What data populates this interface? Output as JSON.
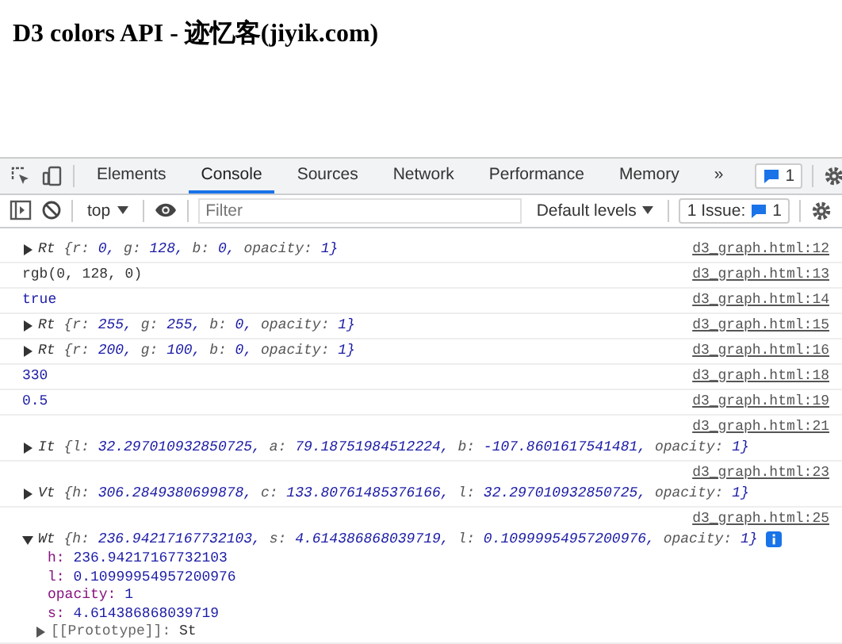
{
  "page": {
    "heading": "D3 colors API - 迹忆客(jiyik.com)"
  },
  "devtools": {
    "tabs": [
      {
        "label": "Elements",
        "selected": false
      },
      {
        "label": "Console",
        "selected": true
      },
      {
        "label": "Sources",
        "selected": false
      },
      {
        "label": "Network",
        "selected": false
      },
      {
        "label": "Performance",
        "selected": false
      },
      {
        "label": "Memory",
        "selected": false
      }
    ],
    "more_tabs": "»",
    "message_count": "1",
    "context": "top",
    "filter": {
      "placeholder": "Filter"
    },
    "levels": "Default levels",
    "issues": {
      "label": "1 Issue:",
      "count": "1"
    }
  },
  "console": [
    {
      "kind": "object",
      "class_name": "Rt",
      "expanded": false,
      "source": "d3_graph.html:12",
      "source_above": false,
      "props": [
        {
          "key": "{r:",
          "value": "0,"
        },
        {
          "key": "g:",
          "value": "128,"
        },
        {
          "key": "b:",
          "value": "0,"
        },
        {
          "key": "opacity:",
          "value": "1}"
        }
      ]
    },
    {
      "kind": "string",
      "text": "rgb(0, 128, 0)",
      "source": "d3_graph.html:13",
      "source_above": false
    },
    {
      "kind": "number",
      "text": "true",
      "source": "d3_graph.html:14",
      "source_above": false
    },
    {
      "kind": "object",
      "class_name": "Rt",
      "expanded": false,
      "source": "d3_graph.html:15",
      "source_above": false,
      "props": [
        {
          "key": "{r:",
          "value": "255,"
        },
        {
          "key": "g:",
          "value": "255,"
        },
        {
          "key": "b:",
          "value": "0,"
        },
        {
          "key": "opacity:",
          "value": "1}"
        }
      ]
    },
    {
      "kind": "object",
      "class_name": "Rt",
      "expanded": false,
      "source": "d3_graph.html:16",
      "source_above": false,
      "props": [
        {
          "key": "{r:",
          "value": "200,"
        },
        {
          "key": "g:",
          "value": "100,"
        },
        {
          "key": "b:",
          "value": "0,"
        },
        {
          "key": "opacity:",
          "value": "1}"
        }
      ]
    },
    {
      "kind": "number",
      "text": "330",
      "source": "d3_graph.html:18",
      "source_above": false
    },
    {
      "kind": "number",
      "text": "0.5",
      "source": "d3_graph.html:19",
      "source_above": false
    },
    {
      "kind": "object",
      "class_name": "It",
      "expanded": false,
      "source": "d3_graph.html:21",
      "source_above": true,
      "props": [
        {
          "key": "{l:",
          "value": "32.297010932850725,"
        },
        {
          "key": "a:",
          "value": "79.18751984512224,"
        },
        {
          "key": "b:",
          "value": "-107.8601617541481,"
        },
        {
          "key": "opacity:",
          "value": "1}"
        }
      ]
    },
    {
      "kind": "object",
      "class_name": "Vt",
      "expanded": false,
      "source": "d3_graph.html:23",
      "source_above": true,
      "props": [
        {
          "key": "{h:",
          "value": "306.2849380699878,"
        },
        {
          "key": "c:",
          "value": "133.80761485376166,"
        },
        {
          "key": "l:",
          "value": "32.297010932850725,"
        },
        {
          "key": "opacity:",
          "value": "1}"
        }
      ]
    },
    {
      "kind": "object",
      "class_name": "Wt",
      "expanded": true,
      "source": "d3_graph.html:25",
      "source_above": true,
      "props": [
        {
          "key": "{h:",
          "value": "236.94217167732103,"
        },
        {
          "key": "s:",
          "value": "4.614386868039719,"
        },
        {
          "key": "l:",
          "value": "0.10999954957200976,"
        },
        {
          "key": "opacity:",
          "value": "1}"
        }
      ],
      "children": [
        {
          "key": "h:",
          "value": "236.94217167732103"
        },
        {
          "key": "l:",
          "value": "0.10999954957200976"
        },
        {
          "key": "opacity:",
          "value": "1"
        },
        {
          "key": "s:",
          "value": "4.614386868039719"
        }
      ],
      "prototype": {
        "key": "[[Prototype]]:",
        "value": "St"
      }
    }
  ]
}
